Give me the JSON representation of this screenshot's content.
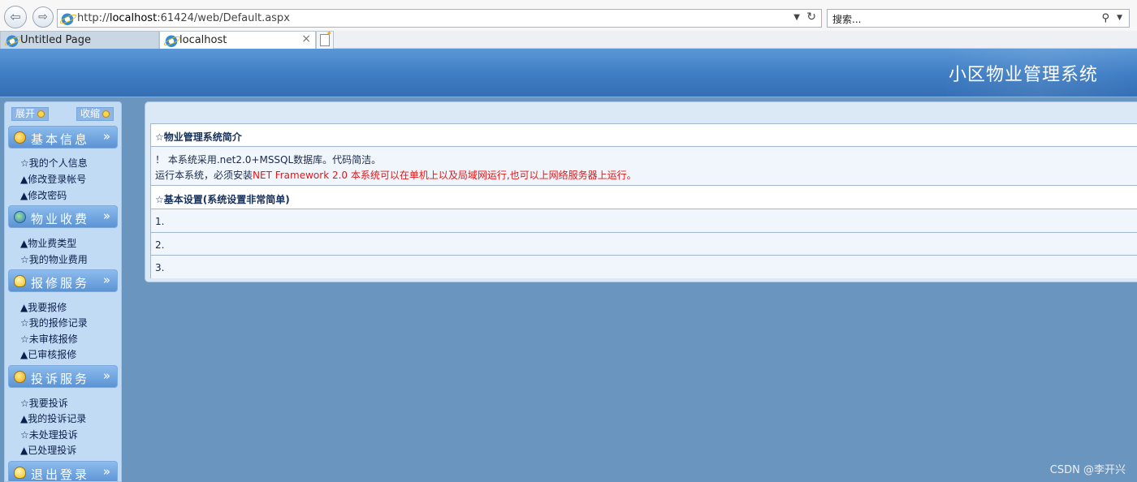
{
  "browser": {
    "url_prefix": "http://",
    "url_host": "localhost",
    "url_rest": ":61424/web/Default.aspx",
    "search_placeholder": "搜索...",
    "tabs": [
      {
        "label": "Untitled Page",
        "active": false
      },
      {
        "label": "localhost",
        "active": true
      }
    ],
    "close_glyph": "×"
  },
  "header": {
    "title": "小区物业管理系统"
  },
  "sidebar": {
    "expand_label": "展开",
    "collapse_label": "收缩",
    "sections": [
      {
        "title": "基本信息",
        "icon": "smiley-icon",
        "items": [
          "☆我的个人信息",
          "▲修改登录帐号",
          "▲修改密码"
        ]
      },
      {
        "title": "物业收费",
        "icon": "globe-icon",
        "items": [
          "▲物业费类型",
          "☆我的物业费用"
        ]
      },
      {
        "title": "报修服务",
        "icon": "bulb-icon",
        "items": [
          "▲我要报修",
          "☆我的报修记录",
          "☆未审核报修",
          "▲已审核报修"
        ]
      },
      {
        "title": "投诉服务",
        "icon": "smiley-icon",
        "items": [
          "☆我要投诉",
          "▲我的投诉记录",
          "☆未处理投诉",
          "▲已处理投诉"
        ]
      },
      {
        "title": "退出登录",
        "icon": "bulb-icon",
        "items": []
      }
    ]
  },
  "main": {
    "intro_title": "☆物业管理系统简介",
    "intro_line1": "！ 本系统采用.net2.0+MSSQL数据库。代码简洁。",
    "intro_line2_prefix": "运行本系统，必须安装",
    "intro_line2_highlight": "NET Framework 2.0 本系统可以在单机上以及局域网运行,也可以上网络服务器上运行。",
    "settings_title": "☆基本设置(系统设置非常简单)",
    "steps": [
      "1.",
      "2.",
      "3."
    ]
  },
  "watermark": "CSDN @李开兴",
  "colors": {
    "banner": "#3e7cc3",
    "sidebar": "#c2dbf4",
    "page_bg": "#6a95bf",
    "highlight": "#e01818"
  }
}
